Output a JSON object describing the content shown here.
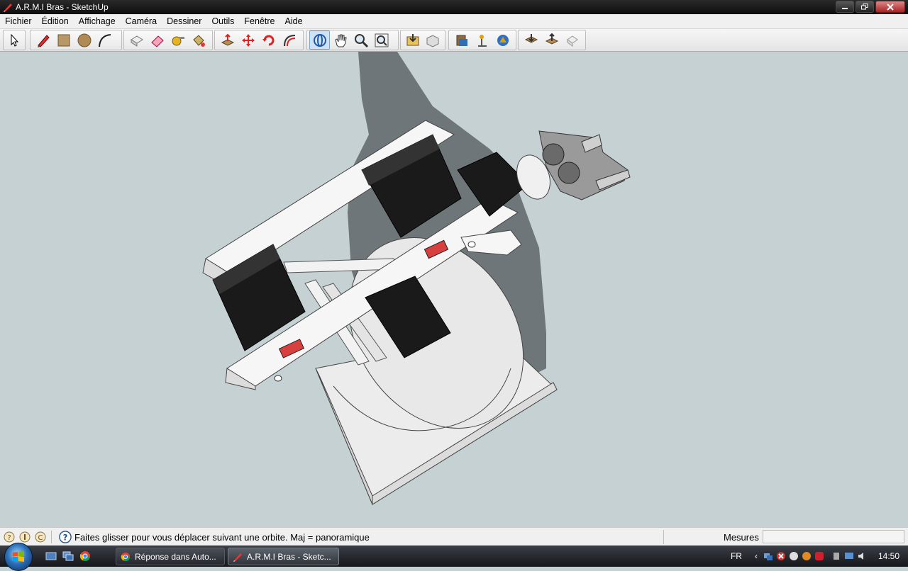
{
  "window": {
    "title": "A.R.M.I Bras - SketchUp"
  },
  "menu": [
    "Fichier",
    "Édition",
    "Affichage",
    "Caméra",
    "Dessiner",
    "Outils",
    "Fenêtre",
    "Aide"
  ],
  "toolbar": {
    "tools": [
      {
        "name": "select-icon"
      },
      {
        "name": "pencil-icon"
      },
      {
        "name": "rectangle-icon"
      },
      {
        "name": "circle-icon"
      },
      {
        "name": "arc-icon"
      },
      {
        "name": "eraser-icon"
      },
      {
        "name": "paint-bucket-icon"
      },
      {
        "name": "tape-measure-icon"
      },
      {
        "name": "component-icon"
      },
      {
        "name": "push-pull-icon"
      },
      {
        "name": "move-icon"
      },
      {
        "name": "rotate-icon"
      },
      {
        "name": "offset-icon"
      },
      {
        "name": "orbit-icon"
      },
      {
        "name": "pan-icon"
      },
      {
        "name": "zoom-icon"
      },
      {
        "name": "zoom-extents-icon"
      },
      {
        "name": "get-models-icon"
      },
      {
        "name": "share-model-icon"
      },
      {
        "name": "photo-textures-icon"
      },
      {
        "name": "add-location-icon"
      },
      {
        "name": "toggle-terrain-icon"
      },
      {
        "name": "download-icon"
      },
      {
        "name": "upload-icon"
      },
      {
        "name": "share-component-icon"
      }
    ]
  },
  "status": {
    "message": "Faites glisser pour vous déplacer suivant une orbite.  Maj = panoramique",
    "measures_label": "Mesures",
    "measures_value": ""
  },
  "taskbar": {
    "tasks": [
      {
        "label": "Réponse dans Auto..."
      },
      {
        "label": "A.R.M.I Bras - Sketc..."
      }
    ],
    "lang": "FR",
    "clock": "14:50"
  },
  "colors": {
    "viewport_bg": "#c5d1d3",
    "taskbar": "#1f2227"
  }
}
